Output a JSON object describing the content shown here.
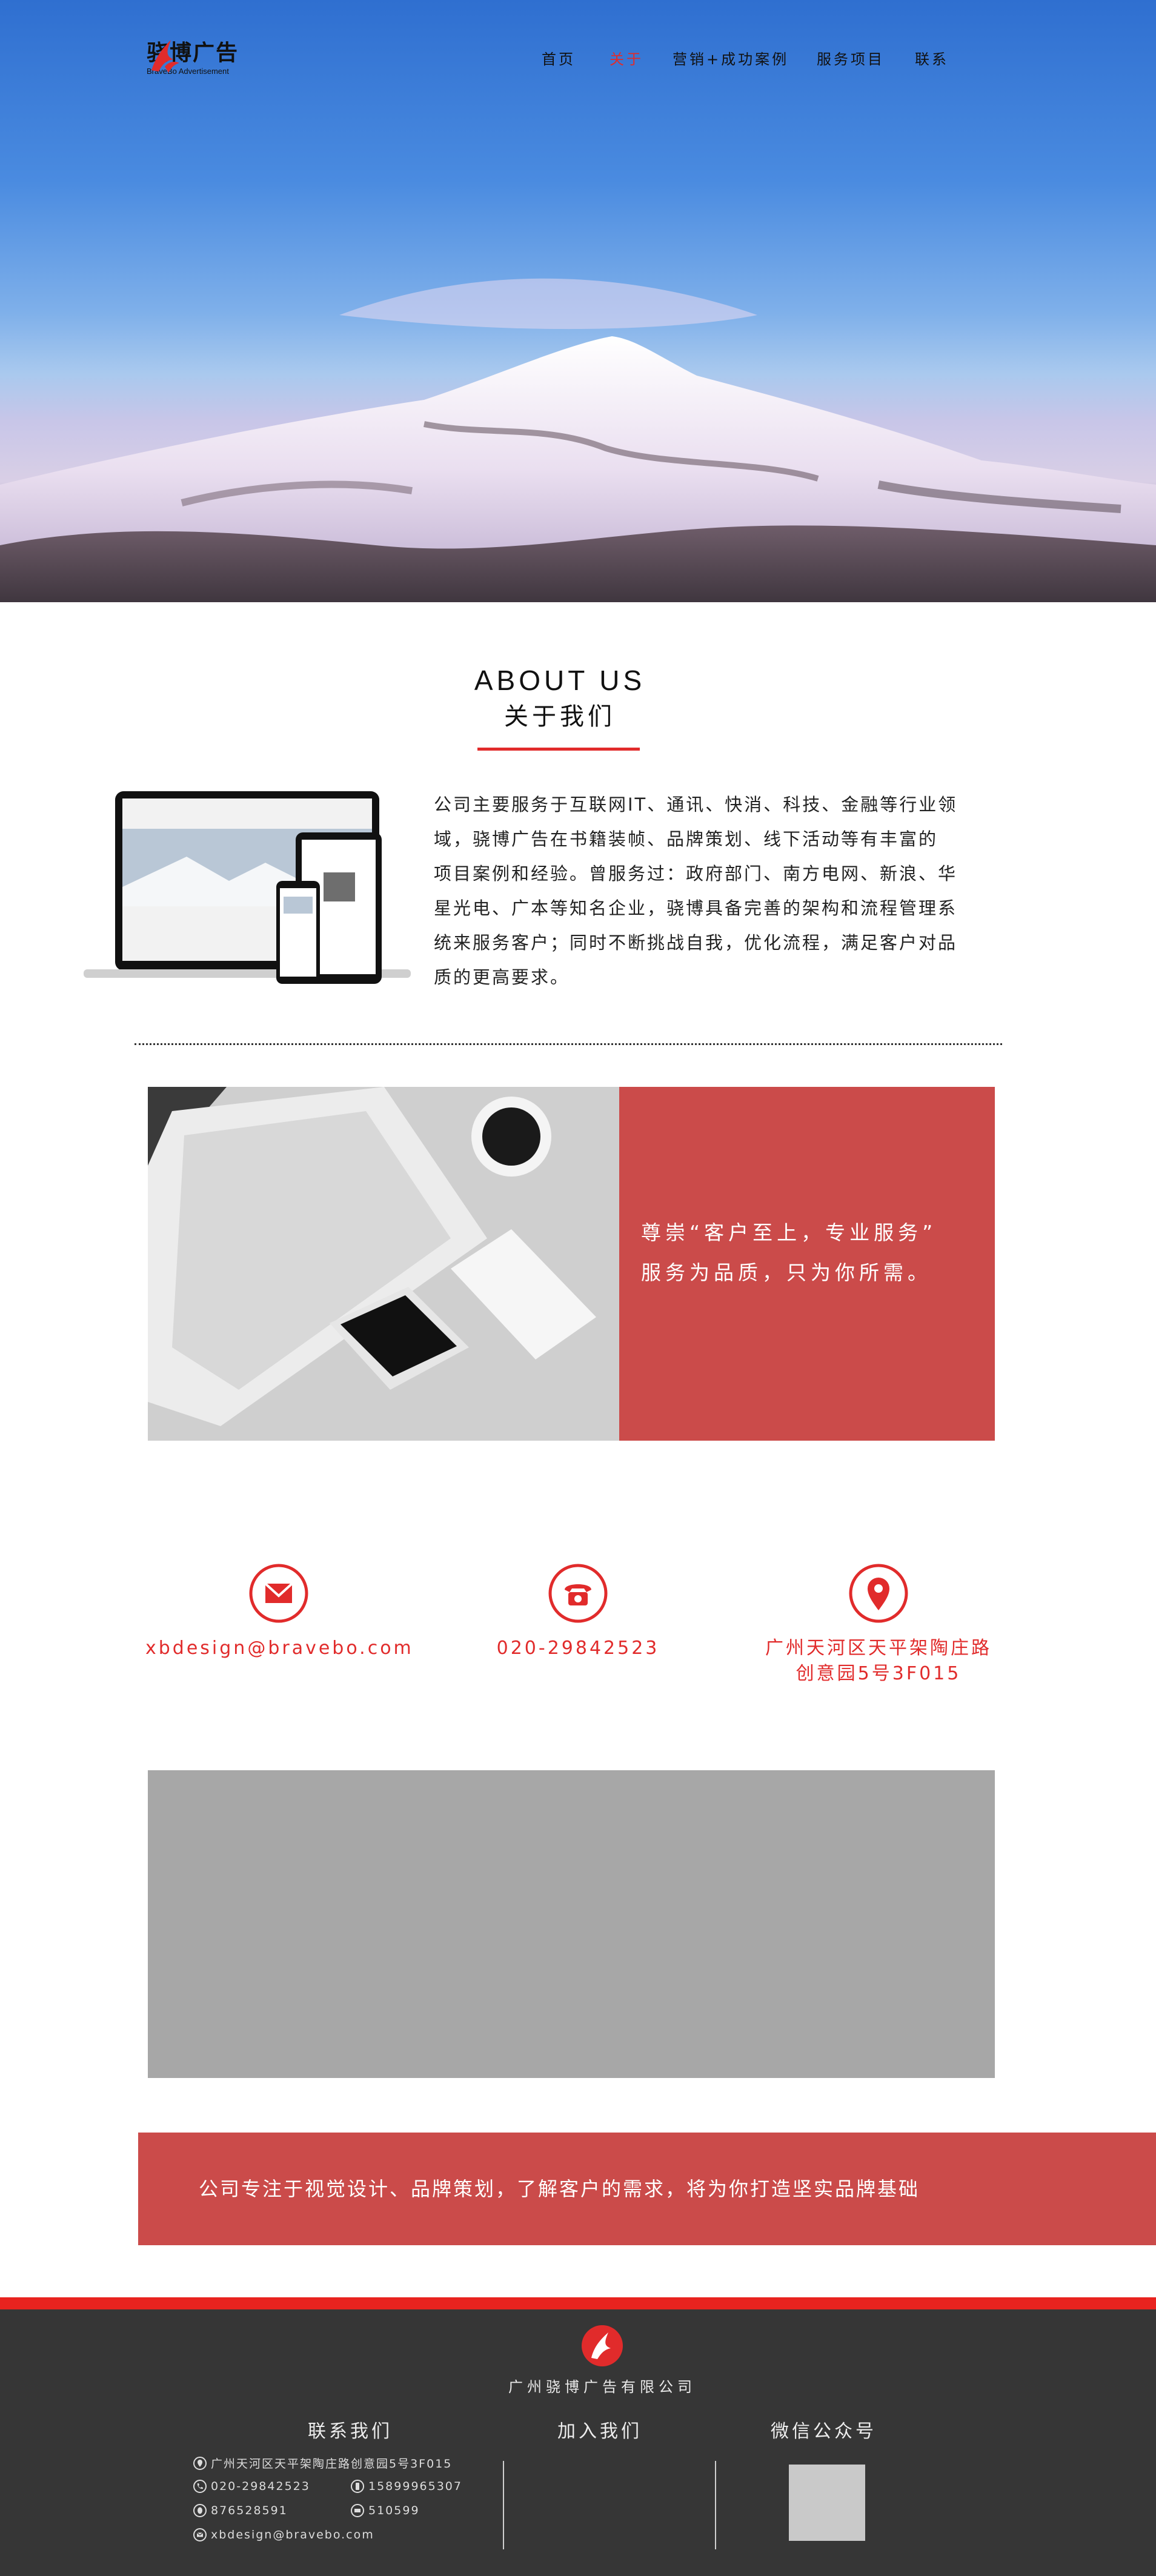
{
  "brand": {
    "name_cn": "骁博广告",
    "name_en": "BraveBo Advertisement"
  },
  "nav": {
    "items": [
      "首页",
      "关于",
      "营销+成功案例",
      "服务项目",
      "联系"
    ],
    "active_index": 1
  },
  "about": {
    "title_en": "ABOUT US",
    "title_cn": "关于我们",
    "lines": [
      "公司主要服务于互联网IT、通讯、快消、科技、金融等行业领",
      "域，骁博广告在书籍装帧、品牌策划、线下活动等有丰富的",
      "项目案例和经验。曾服务过：政府部门、南方电网、新浪、华",
      "星光电、广本等知名企业，骁博具备完善的架构和流程管理系",
      "统来服务客户；同时不断挑战自我，优化流程，满足客户对品",
      "质的更高要求。"
    ]
  },
  "feature": {
    "quote_line1": "尊崇“客户至上，专业服务”",
    "quote_line2": "服务为品质，只为你所需。"
  },
  "contacts": {
    "email": "xbdesign@bravebo.com",
    "phone": "020-29842523",
    "address_line1": "广州天河区天平架陶庄路",
    "address_line2": "创意园5号3F015"
  },
  "banner": {
    "text": "公司专注于视觉设计、品牌策划，了解客户的需求，将为你打造坚实品牌基础"
  },
  "footer": {
    "company": "广州骁博广告有限公司",
    "contact_heading": "联系我们",
    "join_heading": "加入我们",
    "wechat_heading": "微信公众号",
    "address": "广州天河区天平架陶庄路创意园5号3F015",
    "phone": "020-29842523",
    "mobile": "15899965307",
    "qq": "876528591",
    "postcode": "510599",
    "email": "xbdesign@bravebo.com"
  },
  "colors": {
    "accent": "#e12b2b",
    "panel_red": "#cb4b4a",
    "footer_bg": "#363636"
  }
}
